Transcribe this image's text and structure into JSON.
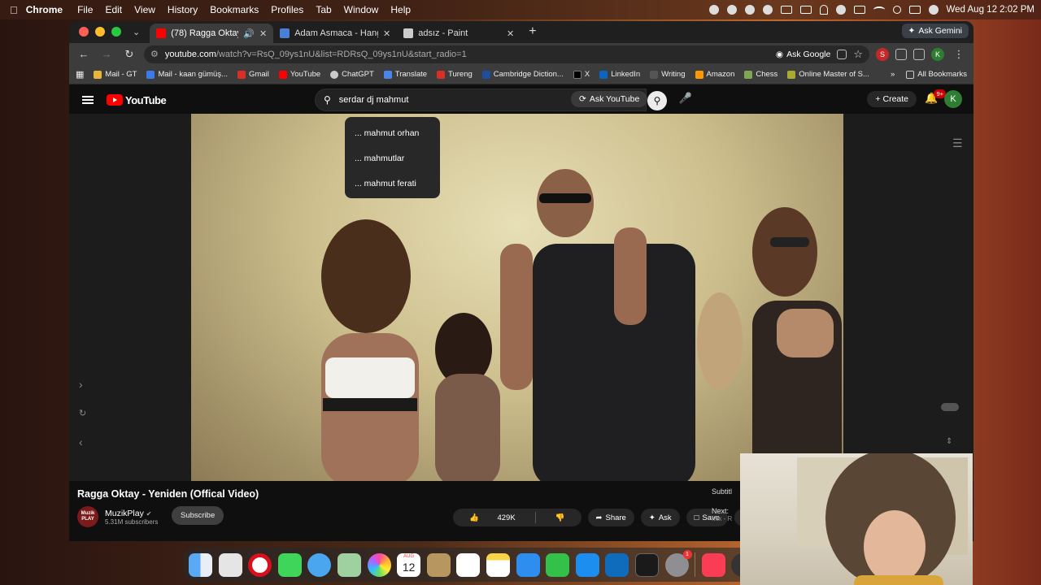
{
  "menubar": {
    "app": "Chrome",
    "menus": [
      "File",
      "Edit",
      "View",
      "History",
      "Bookmarks",
      "Profiles",
      "Tab",
      "Window",
      "Help"
    ],
    "clock": "Wed Aug 12  2:02 PM"
  },
  "tabs": [
    {
      "title": "(78) Ragga Oktay - Yenide",
      "active": true,
      "favicon_color": "#ff0000"
    },
    {
      "title": "Adam Asmaca - Hangman",
      "active": false,
      "favicon_color": "#4a7fd8"
    },
    {
      "title": "adsız - Paint",
      "active": false,
      "favicon_color": "#cccccc"
    }
  ],
  "gemini_label": "Ask Gemini",
  "address": {
    "host": "youtube.com",
    "path": "/watch?v=RsQ_09ys1nU&list=RDRsQ_09ys1nU&start_radio=1"
  },
  "ask_google": "Ask Google",
  "bookmarks": [
    {
      "label": "Mail - GT",
      "color": "#e8b53a"
    },
    {
      "label": "Mail - kaan gümüş...",
      "color": "#3a7be8"
    },
    {
      "label": "Gmail",
      "color": "#d93025"
    },
    {
      "label": "YouTube",
      "color": "#ff0000"
    },
    {
      "label": "ChatGPT",
      "color": "#cccccc"
    },
    {
      "label": "Translate",
      "color": "#4a86e8"
    },
    {
      "label": "Tureng",
      "color": "#d93025"
    },
    {
      "label": "Cambridge Diction...",
      "color": "#1e4f9c"
    },
    {
      "label": "X",
      "color": "#000000"
    },
    {
      "label": "LinkedIn",
      "color": "#0a66c2"
    },
    {
      "label": "Writing",
      "color": "#555555"
    },
    {
      "label": "Amazon",
      "color": "#ff9900"
    },
    {
      "label": "Chess",
      "color": "#7fa650"
    },
    {
      "label": "Online Master of S...",
      "color": "#aaaa33"
    }
  ],
  "all_bookmarks": "All Bookmarks",
  "youtube": {
    "logo": "YouTube",
    "search_value": "serdar dj mahmut",
    "ask_youtube": "Ask YouTube",
    "create": "Create",
    "notif_badge": "9+",
    "avatar_letter": "K",
    "suggestions": [
      "... mahmut orhan",
      "... mahmutlar",
      "... mahmut ferati"
    ],
    "video_title": "Ragga Oktay - Yeniden (Offical Video)",
    "channel": "MuzikPlay",
    "channel_logo_text": "Muzik PLAY",
    "subscribers": "5.31M subscribers",
    "subscribe": "Subscribe",
    "likes": "429K",
    "share": "Share",
    "ask": "Ask",
    "save": "Save",
    "subtitle_tab": "Subtitl",
    "next_label": "Next:",
    "next_sub": "Mix - R"
  },
  "dock": {
    "calendar_month": "AUG",
    "calendar_day": "12",
    "settings_badge": "1"
  }
}
